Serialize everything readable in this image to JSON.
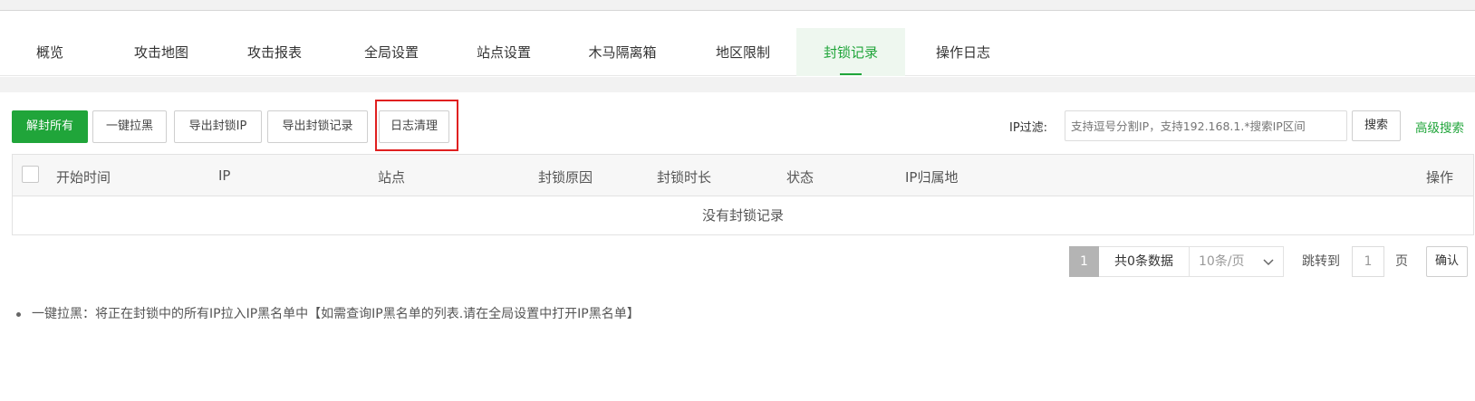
{
  "tabs": [
    {
      "label": "概览",
      "active": false
    },
    {
      "label": "攻击地图",
      "active": false
    },
    {
      "label": "攻击报表",
      "active": false
    },
    {
      "label": "全局设置",
      "active": false
    },
    {
      "label": "站点设置",
      "active": false
    },
    {
      "label": "木马隔离箱",
      "active": false
    },
    {
      "label": "地区限制",
      "active": false
    },
    {
      "label": "封锁记录",
      "active": true
    },
    {
      "label": "操作日志",
      "active": false
    }
  ],
  "toolbar": {
    "unblock_all": "解封所有",
    "blacklist_all": "一键拉黑",
    "export_ip": "导出封锁IP",
    "export_records": "导出封锁记录",
    "clear_log": "日志清理"
  },
  "filter": {
    "label": "IP过滤:",
    "placeholder": "支持逗号分割IP，支持192.168.1.*搜索IP区间",
    "search_button": "搜索",
    "advanced_link": "高级搜索"
  },
  "table": {
    "columns": [
      "开始时间",
      "IP",
      "站点",
      "封锁原因",
      "封锁时长",
      "状态",
      "IP归属地",
      "操作"
    ],
    "empty_text": "没有封锁记录"
  },
  "pagination": {
    "current_page": "1",
    "total_text": "共0条数据",
    "per_page": "10条/页",
    "jump_label": "跳转到",
    "jump_value": "1",
    "page_suffix": "页",
    "confirm": "确认"
  },
  "notes": [
    "一键拉黑：将正在封锁中的所有IP拉入IP黑名单中【如需查询IP黑名单的列表.请在全局设置中打开IP黑名单】"
  ],
  "colors": {
    "accent": "#20a53a",
    "highlight_border": "#e02020"
  }
}
